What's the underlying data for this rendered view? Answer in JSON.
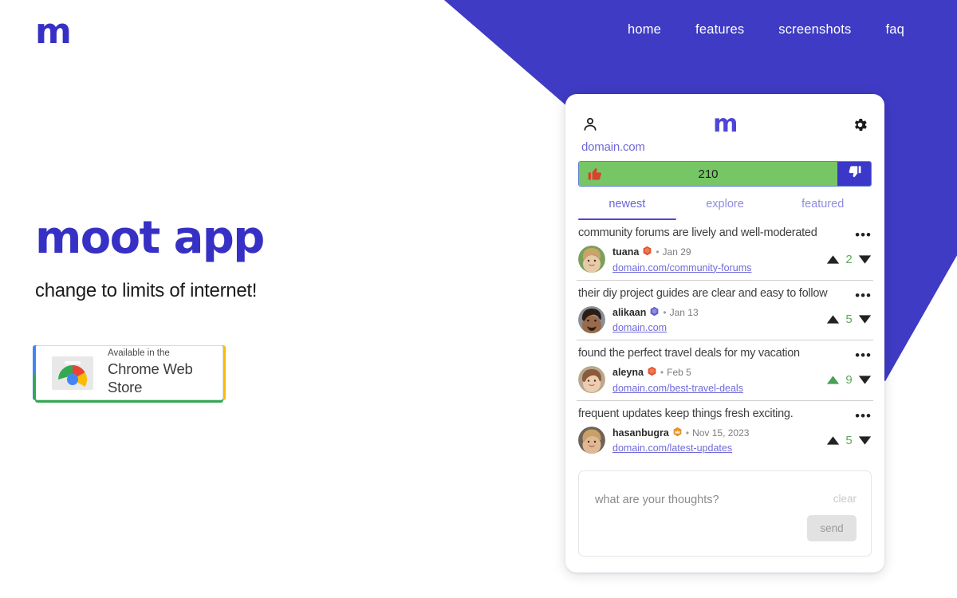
{
  "brand": {
    "logo": "m",
    "accent": "#3730c4"
  },
  "nav": {
    "items": [
      {
        "label": "home"
      },
      {
        "label": "features"
      },
      {
        "label": "screenshots"
      },
      {
        "label": "faq"
      }
    ]
  },
  "hero": {
    "title": "moot app",
    "subtitle": "change to limits of internet!"
  },
  "store_badge": {
    "small_text": "Available in the",
    "big_text": "Chrome Web Store",
    "icon": "chrome-icon"
  },
  "widget": {
    "header": {
      "profile_icon": "person-icon",
      "logo": "m",
      "settings_icon": "gear-icon"
    },
    "domain": "domain.com",
    "votebar": {
      "up_icon": "thumbs-up-icon",
      "count": "210",
      "down_icon": "thumbs-down-icon",
      "fill_color": "#76c665",
      "down_color": "#3b38c9"
    },
    "tabs": [
      {
        "label": "newest",
        "active": true
      },
      {
        "label": "explore",
        "active": false
      },
      {
        "label": "featured",
        "active": false
      }
    ],
    "comments": [
      {
        "title": "community forums are lively and well-moderated",
        "user": "tuana",
        "badge": "gem-badge-red",
        "date": "Jan 29",
        "link": "domain.com/community-forums",
        "score": "2",
        "upvoted": false,
        "menu_icon": "more-options-icon"
      },
      {
        "title": "their diy project guides are clear and easy to follow",
        "user": "alikaan",
        "badge": "gem-badge-blue",
        "date": "Jan 13",
        "link": "domain.com",
        "score": "5",
        "upvoted": false,
        "menu_icon": "more-options-icon"
      },
      {
        "title": "found the perfect travel deals for my vacation",
        "user": "aleyna",
        "badge": "gem-badge-red",
        "date": "Feb 5",
        "link": "domain.com/best-travel-deals",
        "score": "9",
        "upvoted": true,
        "menu_icon": "more-options-icon"
      },
      {
        "title": "frequent updates keep things fresh exciting.",
        "user": "hasanbugra",
        "badge": "crown-badge-gold",
        "date": "Nov 15, 2023",
        "link": "domain.com/latest-updates",
        "score": "5",
        "upvoted": false,
        "menu_icon": "more-options-icon"
      }
    ],
    "composer": {
      "placeholder": "what are your thoughts?",
      "clear_label": "clear",
      "send_label": "send"
    }
  }
}
